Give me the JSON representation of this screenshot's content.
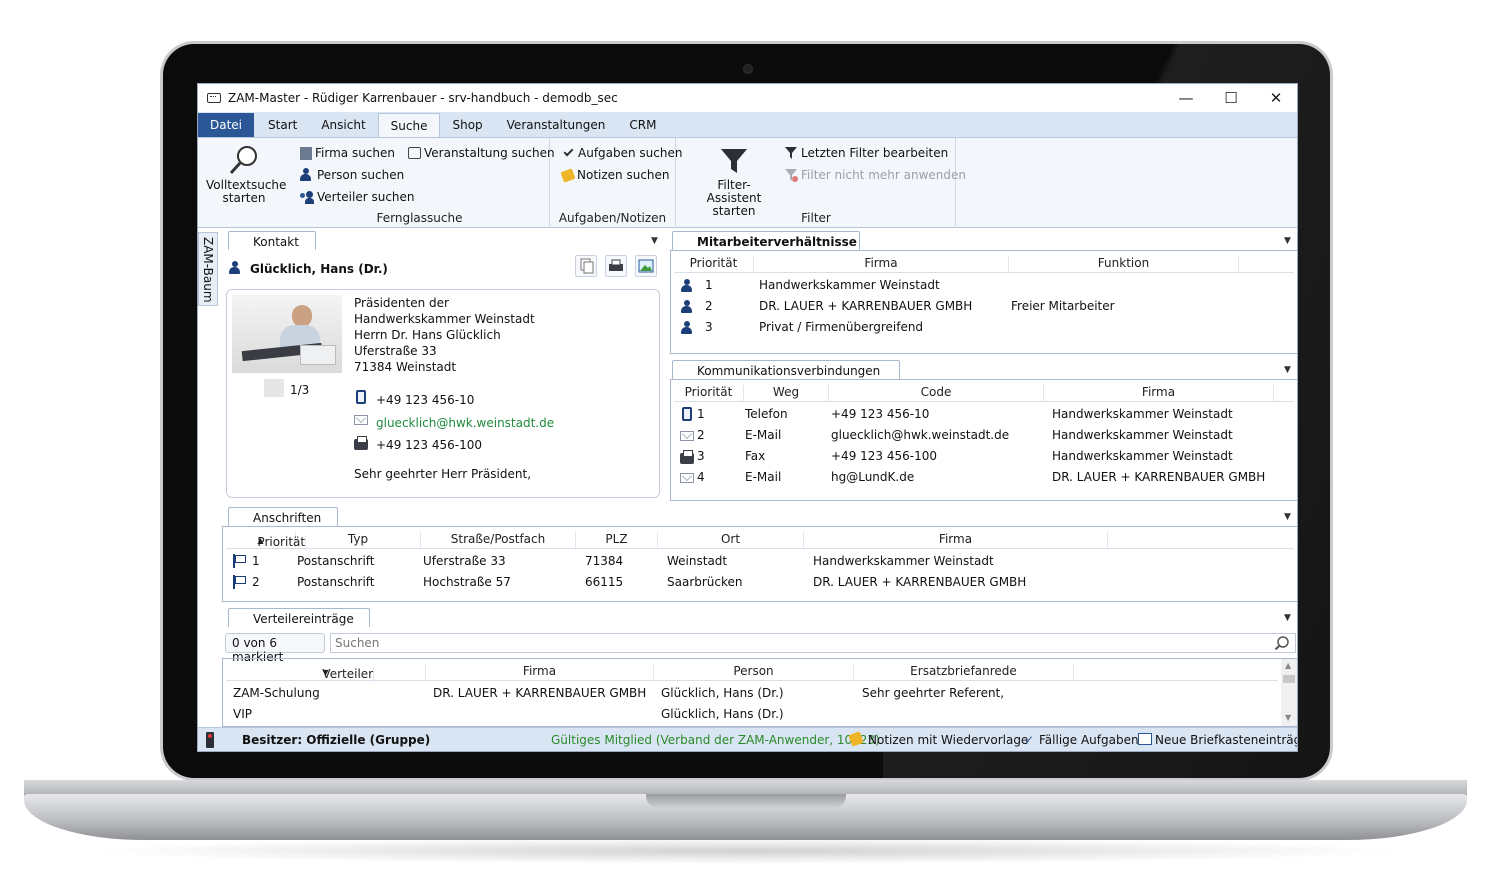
{
  "window": {
    "title": "ZAM-Master - Rüdiger Karrenbauer - srv-handbuch - demodb_sec",
    "minimize": "—",
    "maximize": "☐",
    "close": "✕"
  },
  "menu": {
    "tabs": [
      "Datei",
      "Start",
      "Ansicht",
      "Suche",
      "Shop",
      "Veranstaltungen",
      "CRM"
    ],
    "active": "Suche"
  },
  "ribbon": {
    "volltext": {
      "line1": "Volltextsuche",
      "line2": "starten"
    },
    "fernglas": {
      "firma": "Firma suchen",
      "person": "Person suchen",
      "verteiler": "Verteiler suchen",
      "veranstaltung": "Veranstaltung suchen",
      "label": "Fernglassuche"
    },
    "aufgaben": {
      "aufgaben": "Aufgaben suchen",
      "notizen": "Notizen suchen",
      "label": "Aufgaben/Notizen"
    },
    "filter": {
      "assistent_line1": "Filter-",
      "assistent_line2": "Assistent starten",
      "letzten": "Letzten Filter bearbeiten",
      "nicht_mehr": "Filter nicht mehr anwenden",
      "label": "Filter"
    }
  },
  "side_tab": "ZAM-Baum",
  "kontakt": {
    "tab": "Kontakt",
    "name": "Glücklich, Hans (Dr.)",
    "address": [
      "Präsidenten der",
      "Handwerkskammer Weinstadt",
      "Herrn Dr. Hans Glücklich",
      "Uferstraße 33",
      "71384 Weinstadt"
    ],
    "photo_counter": "1/3",
    "phone": "+49 123 456-10",
    "email": "gluecklich@hwk.weinstadt.de",
    "fax": "+49 123 456-100",
    "salutation": "Sehr geehrter Herr Präsident,"
  },
  "mitarbeiter": {
    "tab": "Mitarbeiterverhältnisse",
    "headers": [
      "Priorität",
      "Firma",
      "Funktion"
    ],
    "rows": [
      {
        "prio": "1",
        "firma": "Handwerkskammer Weinstadt",
        "funktion": ""
      },
      {
        "prio": "2",
        "firma": "DR. LAUER + KARRENBAUER GMBH",
        "funktion": "Freier Mitarbeiter"
      },
      {
        "prio": "3",
        "firma": "Privat / Firmenübergreifend",
        "funktion": ""
      }
    ]
  },
  "kommunikation": {
    "tab": "Kommunikationsverbindungen",
    "headers": [
      "Priorität",
      "Weg",
      "Code",
      "Firma"
    ],
    "rows": [
      {
        "prio": "1",
        "weg": "Telefon",
        "code": "+49 123 456-10",
        "firma": "Handwerkskammer Weinstadt",
        "icon": "phone-icon"
      },
      {
        "prio": "2",
        "weg": "E-Mail",
        "code": "gluecklich@hwk.weinstadt.de",
        "firma": "Handwerkskammer Weinstadt",
        "icon": "mail-icon"
      },
      {
        "prio": "3",
        "weg": "Fax",
        "code": "+49 123 456-100",
        "firma": "Handwerkskammer Weinstadt",
        "icon": "fax-icon"
      },
      {
        "prio": "4",
        "weg": "E-Mail",
        "code": "hg@LundK.de",
        "firma": "DR. LAUER + KARRENBAUER GMBH",
        "icon": "mail-icon"
      }
    ]
  },
  "anschriften": {
    "tab": "Anschriften",
    "headers": [
      "Priorität",
      "Typ",
      "Straße/Postfach",
      "PLZ",
      "Ort",
      "Firma"
    ],
    "rows": [
      {
        "prio": "1",
        "typ": "Postanschrift",
        "strasse": "Uferstraße 33",
        "plz": "71384",
        "ort": "Weinstadt",
        "firma": "Handwerkskammer Weinstadt"
      },
      {
        "prio": "2",
        "typ": "Postanschrift",
        "strasse": "Hochstraße 57",
        "plz": "66115",
        "ort": "Saarbrücken",
        "firma": "DR. LAUER + KARRENBAUER GMBH"
      }
    ]
  },
  "verteiler": {
    "tab": "Verteilereinträge",
    "marked": "0 von 6 markiert",
    "search_placeholder": "Suchen",
    "headers": [
      "Verteiler",
      "Firma",
      "Person",
      "Ersatzbriefanrede"
    ],
    "rows": [
      {
        "verteiler": "ZAM-Schulung",
        "firma": "DR. LAUER + KARRENBAUER GMBH",
        "person": "Glücklich, Hans (Dr.)",
        "anrede": "Sehr geehrter Referent,"
      },
      {
        "verteiler": "VIP",
        "firma": "",
        "person": "Glücklich, Hans (Dr.)",
        "anrede": ""
      }
    ]
  },
  "status": {
    "besitzer": "Besitzer: Offizielle (Gruppe)",
    "mitglied": "Gültiges Mitglied (Verband der ZAM-Anwender, 10023)",
    "notizen": "Notizen mit Wiedervorlage",
    "aufgaben": "Fällige Aufgaben",
    "brief": "Neue Briefkasteneinträge"
  },
  "colors": {
    "ribbon_bg": "#f3f7fb",
    "menu_bg": "#dae5f3",
    "file_tab": "#2b5797",
    "email_green": "#1f8a3b",
    "status_green": "#2a8a2a"
  }
}
